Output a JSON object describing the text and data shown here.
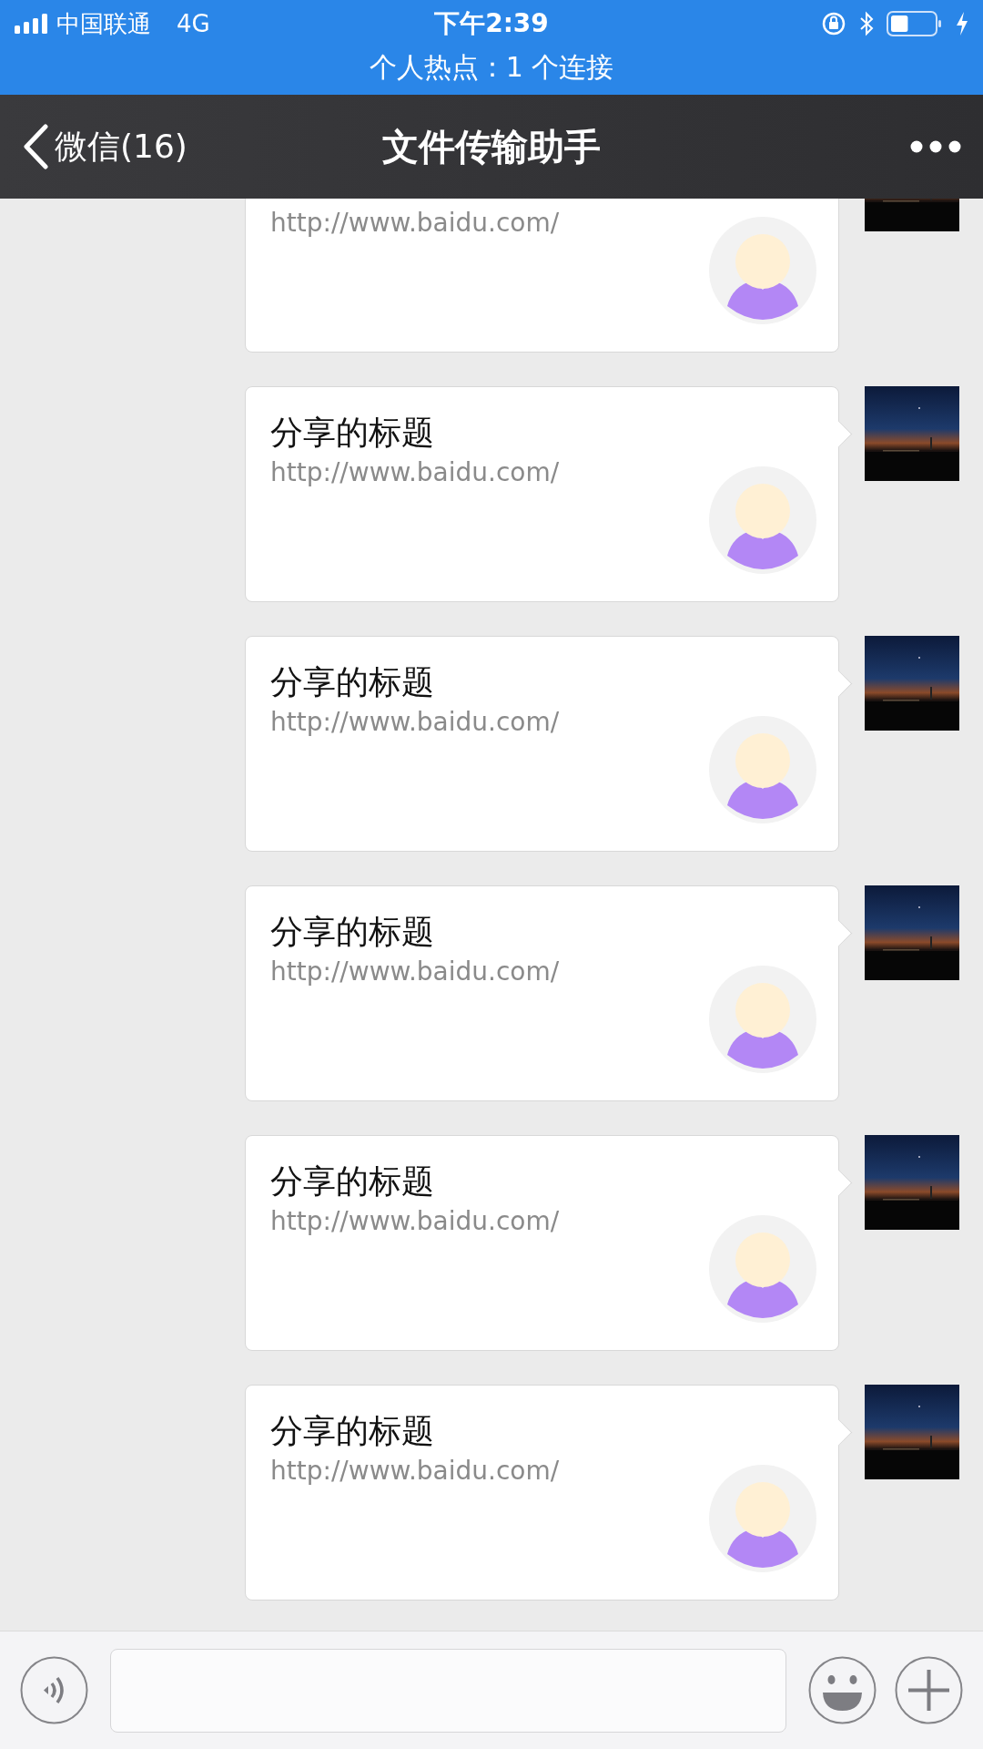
{
  "status_bar": {
    "carrier": "中国联通",
    "network": "4G",
    "time": "下午2:39"
  },
  "hotspot_banner": {
    "text": "个人热点：1 个连接"
  },
  "nav_bar": {
    "back_label": "微信(16)",
    "title": "文件传输助手"
  },
  "messages": [
    {
      "url": "http://www.baidu.com/"
    },
    {
      "title": "分享的标题",
      "url": "http://www.baidu.com/"
    },
    {
      "title": "分享的标题",
      "url": "http://www.baidu.com/"
    },
    {
      "title": "分享的标题",
      "url": "http://www.baidu.com/"
    },
    {
      "title": "分享的标题",
      "url": "http://www.baidu.com/"
    },
    {
      "title": "分享的标题",
      "url": "http://www.baidu.com/"
    }
  ]
}
